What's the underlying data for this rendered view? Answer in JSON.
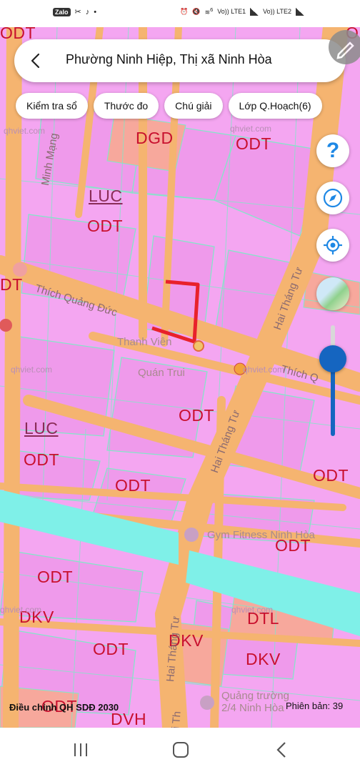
{
  "status_bar": {
    "apps": [
      "Zalo"
    ],
    "network_labels": [
      "Vo)) LTE1",
      "Vo)) LTE2"
    ],
    "network_badge": "6"
  },
  "search": {
    "title": "Phường Ninh Hiệp, Thị xã Ninh Hòa"
  },
  "chips": [
    "Kiểm tra sổ",
    "Thước đo",
    "Chú giải",
    "Lớp Q.Hoạch(6)"
  ],
  "controls": {
    "help_label": "?",
    "opacity_level": 0.7
  },
  "map": {
    "zones": [
      "ODT",
      "ODT",
      "DGD",
      "ODT",
      "LUC",
      "ODT",
      "DT",
      "LUC",
      "ODT",
      "ODT",
      "ODT",
      "ODT",
      "ODT",
      "ODT",
      "DKV",
      "DTL",
      "ODT",
      "DKV",
      "DKV",
      "ODT",
      "DVH"
    ],
    "streets": [
      "Thích Quảng Đức",
      "Hai Tháng Tư",
      "Hai Tháng Tư",
      "Hai Tháng Tư",
      "Minh Mạng",
      "Thích Q",
      "Hai Th"
    ],
    "pois": [
      "Thanh Viên",
      "Quán Trui",
      "Gym Fitness Ninh Hòa",
      "Quảng trường 2/4 Ninh Hòa"
    ],
    "watermarks": [
      "qhviet.com",
      "qhviet.com",
      "qhviet.com",
      "qhviet.com",
      "qhviet.com",
      "qhviet.com"
    ]
  },
  "footer": {
    "left": "Điều chỉnh QH SDĐ 2030",
    "right": "Phiên bản: 39"
  },
  "colors": {
    "residential": "#f4a6f1",
    "road": "#f5b470",
    "water": "#7ff0e8",
    "zone_text": "#c8102e",
    "accent": "#1565c0",
    "marked_area": "#e8212b"
  }
}
